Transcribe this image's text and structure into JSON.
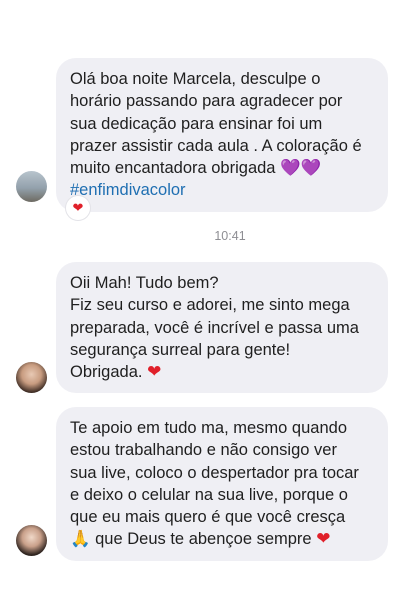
{
  "messages": [
    {
      "lines": [
        "Olá boa noite Marcela, desculpe o",
        "horário passando para agradecer por",
        "sua dedicação para ensinar foi um",
        "prazer assistir cada aula . A coloração é",
        "muito encantadora obrigada"
      ],
      "emoji": "💜💜",
      "hashtag": "#enfimdivacolor",
      "reaction": "❤"
    },
    {
      "lines": [
        "Oii Mah! Tudo bem?",
        "Fiz seu curso e adorei, me sinto mega",
        "preparada, você é incrível e passa uma",
        "segurança surreal para gente!",
        "Obrigada."
      ],
      "emoji": "❤"
    },
    {
      "lines": [
        "Te apoio em tudo ma, mesmo quando",
        "estou trabalhando e não consigo ver",
        "sua live, coloco o despertador pra tocar",
        "e deixo o celular na sua live, porque o",
        "que eu mais quero é que você cresça"
      ],
      "last_prefix_emoji": "🙏",
      "last_text": " que Deus te abençoe sempre ",
      "emoji": "❤"
    }
  ],
  "timestamp": "10:41",
  "colors": {
    "bubble": "#efeff4",
    "hashtag": "#1f6fb2",
    "heart": "#e0202a",
    "timestamp": "#8e8e93"
  }
}
